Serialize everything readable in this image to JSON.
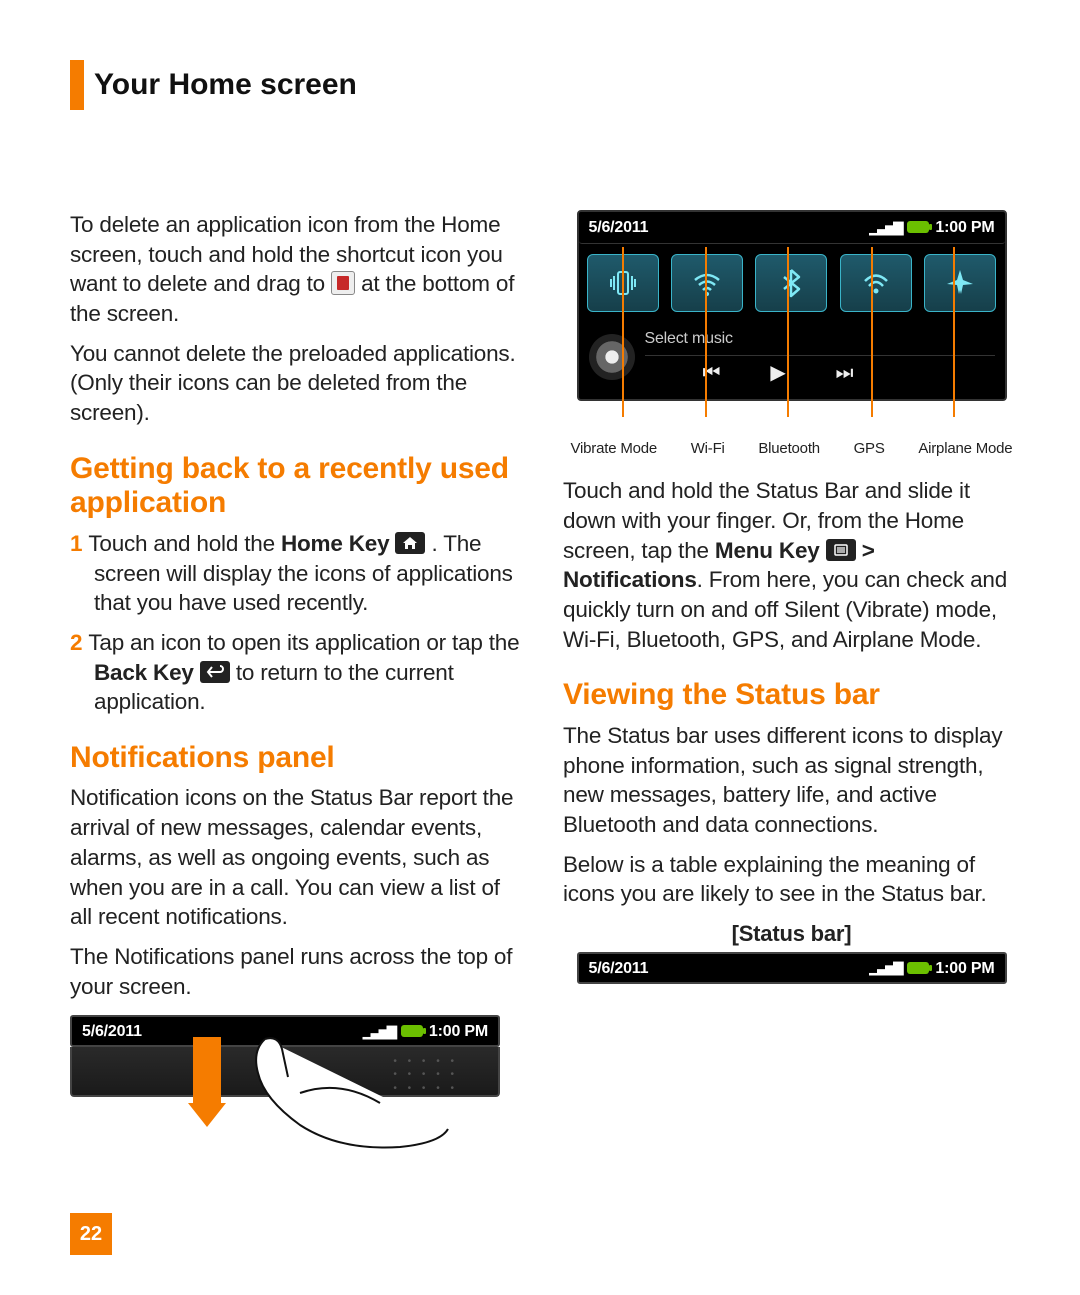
{
  "chapterTitle": "Your Home screen",
  "left": {
    "intro1_a": "To delete an application icon from the Home screen, touch and hold the shortcut icon you want to delete and drag to ",
    "intro1_b": " at the bottom of the screen.",
    "intro2": "You cannot delete the preloaded applications. (Only their icons can be deleted from the screen).",
    "h1": "Getting back to a recently used application",
    "step1_a": "Touch and hold the ",
    "step1_home": "Home Key",
    "step1_b": " . The screen will display the icons of applications that you have used recently.",
    "step2_a": "Tap an icon to open its application or tap the ",
    "step2_back": "Back Key",
    "step2_b": " to return to the current application.",
    "h2": "Notifications panel",
    "notif_p1": "Notification icons on the Status Bar report the arrival of new messages, calendar events, alarms, as well as ongoing events, such as when you are in a call. You can view a list of all recent notifications.",
    "notif_p2": "The Notifications panel runs across the top of your screen.",
    "statusDate": "5/6/2011",
    "statusTime": "1:00 PM"
  },
  "right": {
    "statusDate": "5/6/2011",
    "statusTime": "1:00 PM",
    "musicLabel": "Select music",
    "labels": {
      "vibrate": "Vibrate Mode",
      "wifi": "Wi-Fi",
      "bt": "Bluetooth",
      "gps": "GPS",
      "airplane": "Airplane Mode"
    },
    "p1_a": "Touch and hold the Status Bar and slide it down with your finger. Or, from the Home screen, tap the ",
    "p1_menu": "Menu Key",
    "p1_gt": " > ",
    "p1_notif": "Notifications",
    "p1_b": ". From here, you can check and quickly turn on and off Silent (Vibrate) mode, Wi-Fi, Bluetooth, GPS, and Airplane Mode.",
    "h3": "Viewing the Status bar",
    "p2": "The Status bar uses different icons to display phone information, such as signal strength, new messages, battery life, and active Bluetooth and data connections.",
    "p3": "Below is a table explaining the meaning of icons you are likely to see in the Status bar.",
    "sbLabel": "[Status bar]"
  },
  "pageNumber": "22"
}
